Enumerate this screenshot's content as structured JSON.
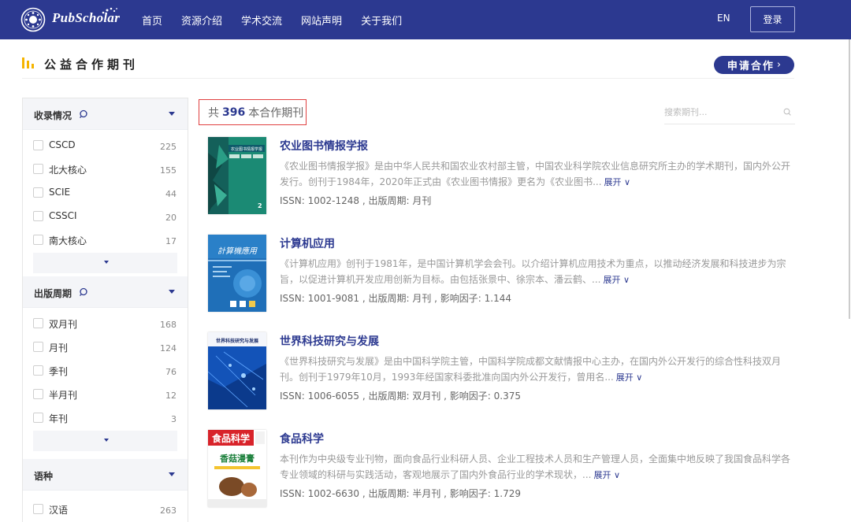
{
  "nav": {
    "brand": "PubScholar",
    "menu": [
      "首页",
      "资源介绍",
      "学术交流",
      "网站声明",
      "关于我们"
    ],
    "lang": "EN",
    "login": "登录",
    "bg_color": "#2c3990"
  },
  "section": {
    "title": "公益合作期刊",
    "apply_label": "申请合作",
    "apply_chevron": "›"
  },
  "filters": [
    {
      "label": "收录情况",
      "options": [
        {
          "name": "CSCD",
          "count": "225"
        },
        {
          "name": "北大核心",
          "count": "155"
        },
        {
          "name": "SCIE",
          "count": "44"
        },
        {
          "name": "CSSCI",
          "count": "20"
        },
        {
          "name": "南大核心",
          "count": "17"
        }
      ]
    },
    {
      "label": "出版周期",
      "options": [
        {
          "name": "双月刊",
          "count": "168"
        },
        {
          "name": "月刊",
          "count": "124"
        },
        {
          "name": "季刊",
          "count": "76"
        },
        {
          "name": "半月刊",
          "count": "12"
        },
        {
          "name": "年刊",
          "count": "3"
        }
      ]
    },
    {
      "label": "语种",
      "options": [
        {
          "name": "汉语",
          "count": "263"
        }
      ]
    }
  ],
  "results": {
    "prefix": "共",
    "count": "396",
    "suffix": "本合作期刊",
    "search_placeholder": "搜索期刊..."
  },
  "journals": [
    {
      "title": "农业图书情报学报",
      "desc": "《农业图书情报学报》是由中华人民共和国农业农村部主管，中国农业科学院农业信息研究所主办的学术期刊，国内外公开发行。创刊于1984年，2020年正式由《农业图书情报》更名为《农业图书...",
      "expand": "展开 ∨",
      "meta": "ISSN:  1002-1248 , 出版周期:  月刊",
      "cover_text": "农业图书情报学报",
      "cover_num": "2"
    },
    {
      "title": "计算机应用",
      "desc": "《计算机应用》创刊于1981年，是中国计算机学会会刊。以介绍计算机应用技术为重点，以推动经济发展和科技进步为宗旨，以促进计算机开发应用创新为目标。由包括张景中、徐宗本、潘云鹤、...",
      "expand": "展开 ∨",
      "meta": "ISSN:  1001-9081 , 出版周期:  月刊 , 影响因子:  1.144",
      "cover_text": "计算机应用"
    },
    {
      "title": "世界科技研究与发展",
      "desc": "《世界科技研究与发展》是由中国科学院主管，中国科学院成都文献情报中心主办，在国内外公开发行的综合性科技双月刊。创刊于1979年10月，1993年经国家科委批准向国内外公开发行，曾用名...",
      "expand": "展开 ∨",
      "meta": "ISSN:  1006-6055 , 出版周期:  双月刊 , 影响因子:  0.375",
      "cover_text": "世界科技研究与发展"
    },
    {
      "title": "食品科学",
      "desc": "本刊作为中央级专业刊物，面向食品行业科研人员、企业工程技术人员和生产管理人员，全面集中地反映了我国食品科学各专业领域的科研与实践活动，客观地展示了国内外食品行业的学术现状，...",
      "expand": "展开 ∨",
      "meta": "ISSN:  1002-6630 , 出版周期:  半月刊 , 影响因子:  1.729",
      "cover_text": "食品科学",
      "cover_sub": "香菇漫膏"
    }
  ]
}
